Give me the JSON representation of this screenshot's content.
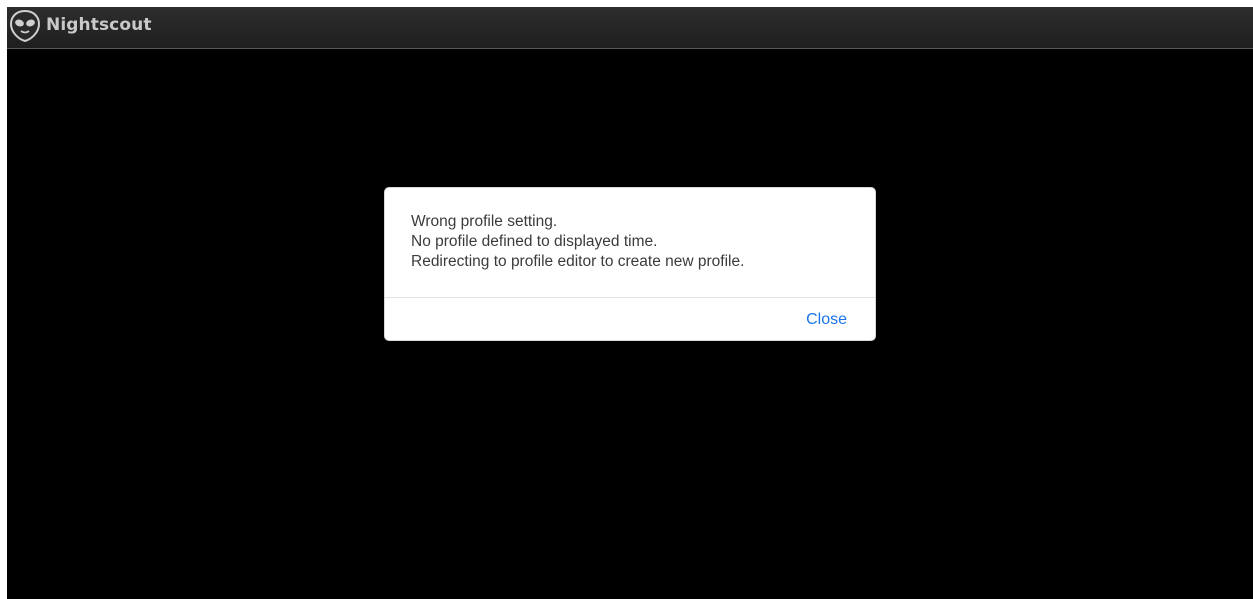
{
  "header": {
    "app_title": "Nightscout",
    "logo_icon": "alien-head-icon"
  },
  "dialog": {
    "lines": [
      "Wrong profile setting.",
      "No profile defined to displayed time.",
      "Redirecting to profile editor to create new profile."
    ],
    "close_label": "Close"
  },
  "colors": {
    "background": "#000000",
    "topbar": "#262626",
    "link": "#1a73e8"
  }
}
